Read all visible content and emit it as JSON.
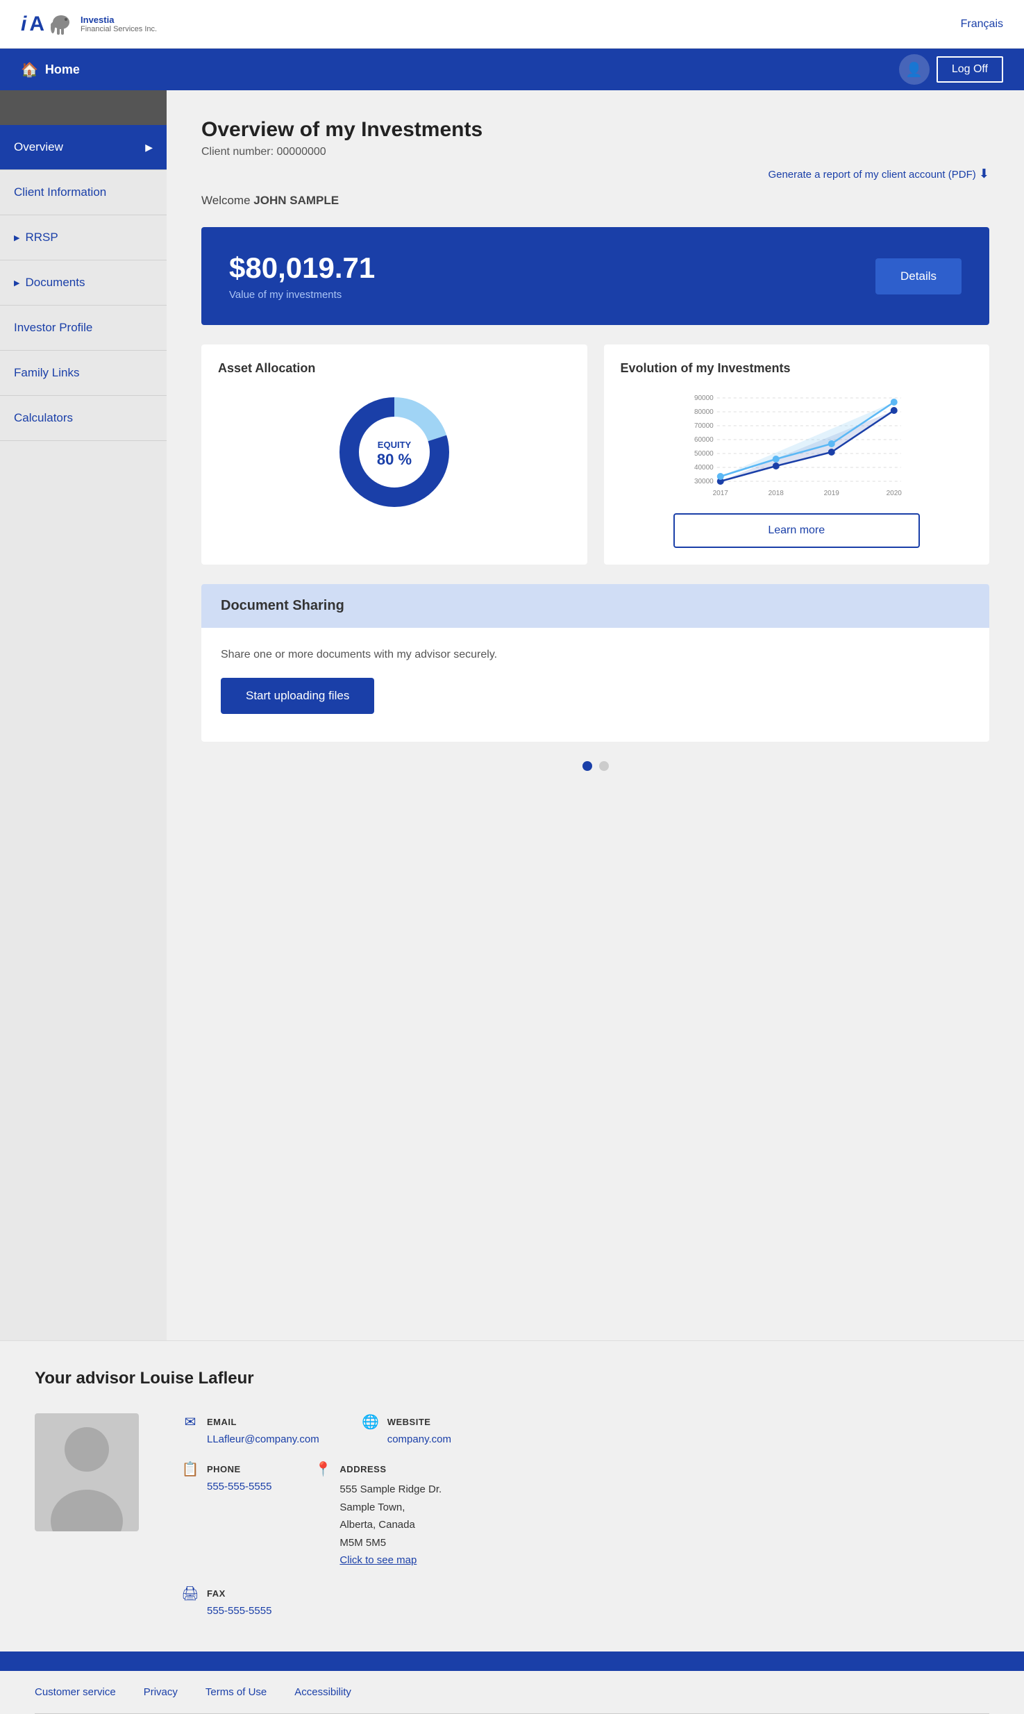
{
  "topbar": {
    "logo_text": "iA",
    "logo_company": "Investia",
    "logo_sub": "Financial Services Inc.",
    "francais": "Français"
  },
  "navbar": {
    "home_label": "Home",
    "logoff_label": "Log Off"
  },
  "sidebar": {
    "items": [
      {
        "label": "Overview",
        "active": true,
        "arrow": false
      },
      {
        "label": "Client Information",
        "active": false,
        "arrow": false
      },
      {
        "label": "RRSP",
        "active": false,
        "arrow": true
      },
      {
        "label": "Documents",
        "active": false,
        "arrow": true
      },
      {
        "label": "Investor Profile",
        "active": false,
        "arrow": false
      },
      {
        "label": "Family Links",
        "active": false,
        "arrow": false
      },
      {
        "label": "Calculators",
        "active": false,
        "arrow": false
      }
    ]
  },
  "page": {
    "title": "Overview of my Investments",
    "client_number_label": "Client number:",
    "client_number": "00000000",
    "report_link": "Generate a report of my client account (PDF)",
    "welcome": "Welcome",
    "username": "JOHN SAMPLE"
  },
  "investment": {
    "amount": "$80,019.71",
    "label": "Value of my investments",
    "details_label": "Details"
  },
  "asset_allocation": {
    "title": "Asset Allocation",
    "equity_label": "EQUITY",
    "equity_percent": "80 %"
  },
  "evolution": {
    "title": "Evolution of my Investments",
    "learn_more": "Learn more",
    "y_labels": [
      "90000",
      "80000",
      "70000",
      "60000",
      "50000",
      "40000",
      "30000"
    ],
    "x_labels": [
      "2017",
      "2018",
      "2019",
      "2020"
    ]
  },
  "document_sharing": {
    "title": "Document Sharing",
    "description": "Share one or more documents with my advisor securely.",
    "upload_label": "Start uploading files"
  },
  "dots": {
    "active": 0,
    "total": 2
  },
  "advisor": {
    "title_prefix": "Your advisor",
    "name": "Louise Lafleur",
    "email_label": "EMAIL",
    "email": "LLafleur@company.com",
    "phone_label": "PHONE",
    "phone": "555-555-5555",
    "fax_label": "FAX",
    "fax": "555-555-5555",
    "website_label": "WEBSITE",
    "website": "company.com",
    "address_label": "ADDRESS",
    "address_line1": "555 Sample Ridge Dr.",
    "address_line2": "Sample Town,",
    "address_line3": "Alberta, Canada",
    "address_line4": "M5M 5M5",
    "map_link": "Click to see map"
  },
  "footer": {
    "bar_color": "#1a3fa8",
    "links": [
      {
        "label": "Customer service"
      },
      {
        "label": "Privacy"
      },
      {
        "label": "Terms of Use"
      },
      {
        "label": "Accessibility"
      }
    ]
  }
}
